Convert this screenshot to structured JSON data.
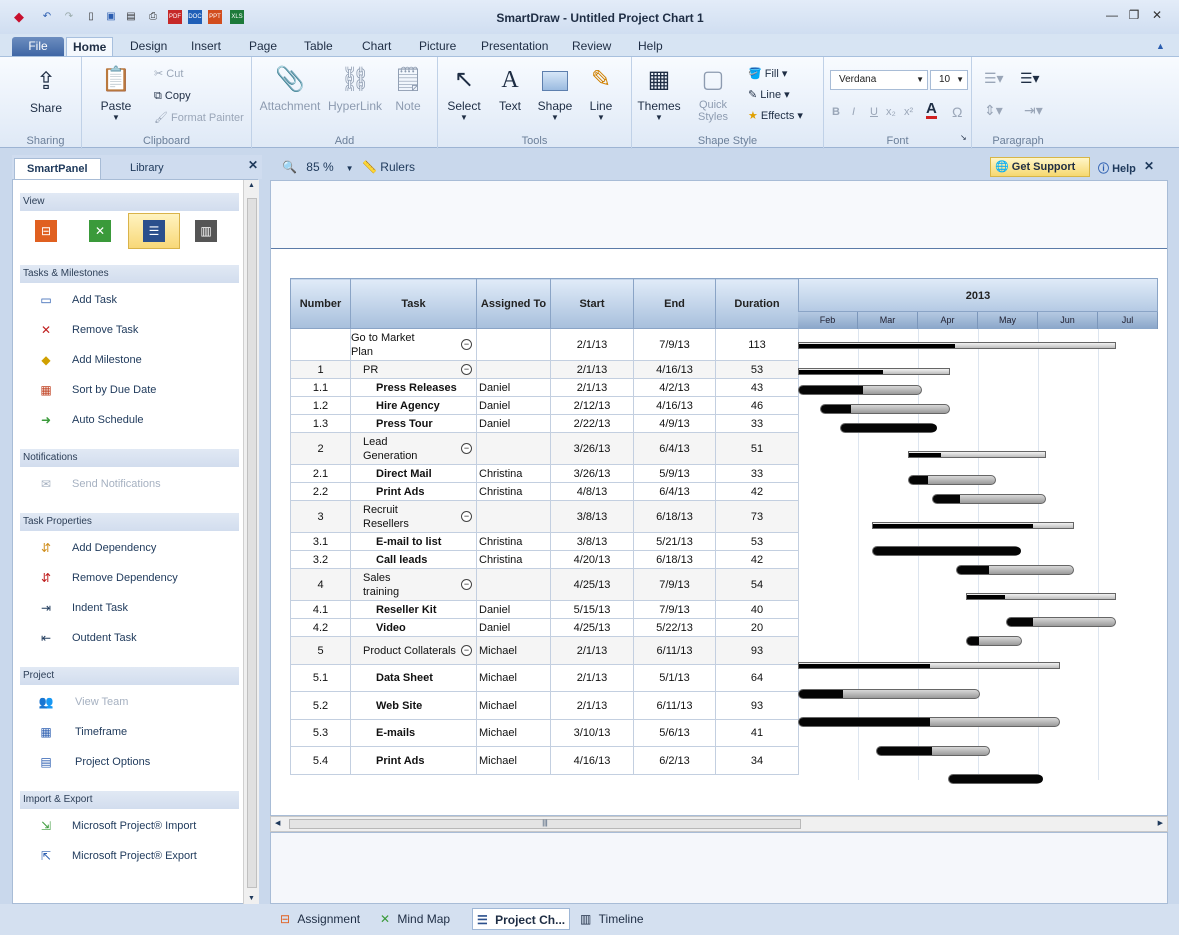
{
  "app": {
    "title": "SmartDraw - Untitled Project Chart 1"
  },
  "ribbon_tabs": [
    "File",
    "Home",
    "Design",
    "Insert",
    "Page",
    "Table",
    "Chart",
    "Picture",
    "Presentation",
    "Review",
    "Help"
  ],
  "ribbon": {
    "sharing": {
      "label": "Sharing",
      "share": "Share"
    },
    "clipboard": {
      "label": "Clipboard",
      "paste": "Paste",
      "cut": "Cut",
      "copy": "Copy",
      "format_painter": "Format Painter"
    },
    "add": {
      "label": "Add",
      "attachment": "Attachment",
      "hyperlink": "HyperLink",
      "note": "Note"
    },
    "tools": {
      "label": "Tools",
      "select": "Select",
      "text": "Text",
      "shape": "Shape",
      "line": "Line"
    },
    "shape_style": {
      "label": "Shape Style",
      "themes": "Themes",
      "quick_styles_1": "Quick",
      "quick_styles_2": "Styles",
      "fill": "Fill",
      "line": "Line",
      "effects": "Effects"
    },
    "font": {
      "label": "Font",
      "face": "Verdana",
      "size": "10"
    },
    "paragraph": {
      "label": "Paragraph"
    }
  },
  "panel": {
    "tabs": [
      "SmartPanel",
      "Library"
    ],
    "sections": {
      "view": "View",
      "tasks": "Tasks & Milestones",
      "notifications": "Notifications",
      "task_props": "Task Properties",
      "project": "Project",
      "import_export": "Import & Export"
    },
    "tasks_items": [
      "Add Task",
      "Remove Task",
      "Add Milestone",
      "Sort by Due Date",
      "Auto Schedule"
    ],
    "notif_items": [
      "Send Notifications"
    ],
    "prop_items": [
      "Add Dependency",
      "Remove Dependency",
      "Indent Task",
      "Outdent Task"
    ],
    "project_items": [
      "View Team",
      "Timeframe",
      "Project Options"
    ],
    "ie_items": [
      "Microsoft Project® Import",
      "Microsoft Project® Export"
    ]
  },
  "canvas_toolbar": {
    "zoom": "85 %",
    "rulers": "Rulers",
    "get_support": "Get Support",
    "help": "Help"
  },
  "table": {
    "headers": [
      "Number",
      "Task",
      "Assigned To",
      "Start",
      "End",
      "Duration"
    ],
    "year": "2013",
    "months": [
      "Feb",
      "Mar",
      "Apr",
      "May",
      "Jun",
      "Jul"
    ],
    "rows": [
      {
        "num": "",
        "task1": "Go to Market",
        "task2": "Plan",
        "assigned": "",
        "start": "2/1/13",
        "end": "7/9/13",
        "dur": "113",
        "level": 0,
        "summary": true,
        "h": 32,
        "bar": [
          0,
          318
        ],
        "prog": 0.49
      },
      {
        "num": "1",
        "task1": "PR",
        "task2": "",
        "assigned": "",
        "start": "2/1/13",
        "end": "4/16/13",
        "dur": "53",
        "level": 1,
        "summary": true,
        "h": 18,
        "bar": [
          0,
          152
        ],
        "prog": 0.55
      },
      {
        "num": "1.1",
        "task1": "Press Releases",
        "task2": "",
        "assigned": "Daniel",
        "start": "2/1/13",
        "end": "4/2/13",
        "dur": "43",
        "level": 2,
        "summary": false,
        "h": 18,
        "bar": [
          0,
          124
        ],
        "prog": 0.52
      },
      {
        "num": "1.2",
        "task1": "Hire Agency",
        "task2": "",
        "assigned": "Daniel",
        "start": "2/12/13",
        "end": "4/16/13",
        "dur": "46",
        "level": 2,
        "summary": false,
        "h": 18,
        "bar": [
          22,
          152
        ],
        "prog": 0.23
      },
      {
        "num": "1.3",
        "task1": "Press Tour",
        "task2": "",
        "assigned": "Daniel",
        "start": "2/22/13",
        "end": "4/9/13",
        "dur": "33",
        "level": 2,
        "summary": false,
        "h": 18,
        "bar": [
          42,
          138
        ],
        "prog": 1.0
      },
      {
        "num": "2",
        "task1": "Lead",
        "task2": "Generation",
        "assigned": "",
        "start": "3/26/13",
        "end": "6/4/13",
        "dur": "51",
        "level": 1,
        "summary": true,
        "h": 32,
        "bar": [
          110,
          248
        ],
        "prog": 0.23
      },
      {
        "num": "2.1",
        "task1": "Direct Mail",
        "task2": "",
        "assigned": "Christina",
        "start": "3/26/13",
        "end": "5/9/13",
        "dur": "33",
        "level": 2,
        "summary": false,
        "h": 18,
        "bar": [
          110,
          198
        ],
        "prog": 0.22
      },
      {
        "num": "2.2",
        "task1": "Print Ads",
        "task2": "",
        "assigned": "Christina",
        "start": "4/8/13",
        "end": "6/4/13",
        "dur": "42",
        "level": 2,
        "summary": false,
        "h": 18,
        "bar": [
          134,
          248
        ],
        "prog": 0.24
      },
      {
        "num": "3",
        "task1": "Recruit",
        "task2": "Resellers",
        "assigned": "",
        "start": "3/8/13",
        "end": "6/18/13",
        "dur": "73",
        "level": 1,
        "summary": true,
        "h": 32,
        "bar": [
          74,
          276
        ],
        "prog": 0.79
      },
      {
        "num": "3.1",
        "task1": "E-mail to list",
        "task2": "",
        "assigned": "Christina",
        "start": "3/8/13",
        "end": "5/21/13",
        "dur": "53",
        "level": 2,
        "summary": false,
        "h": 18,
        "bar": [
          74,
          222
        ],
        "prog": 1.0
      },
      {
        "num": "3.2",
        "task1": "Call leads",
        "task2": "",
        "assigned": "Christina",
        "start": "4/20/13",
        "end": "6/18/13",
        "dur": "42",
        "level": 2,
        "summary": false,
        "h": 18,
        "bar": [
          158,
          276
        ],
        "prog": 0.27
      },
      {
        "num": "4",
        "task1": "Sales",
        "task2": "training",
        "assigned": "",
        "start": "4/25/13",
        "end": "7/9/13",
        "dur": "54",
        "level": 1,
        "summary": true,
        "h": 32,
        "bar": [
          168,
          318
        ],
        "prog": 0.25
      },
      {
        "num": "4.1",
        "task1": "Reseller Kit",
        "task2": "",
        "assigned": "Daniel",
        "start": "5/15/13",
        "end": "7/9/13",
        "dur": "40",
        "level": 2,
        "summary": false,
        "h": 18,
        "bar": [
          208,
          318
        ],
        "prog": 0.24
      },
      {
        "num": "4.2",
        "task1": "Video",
        "task2": "",
        "assigned": "Daniel",
        "start": "4/25/13",
        "end": "5/22/13",
        "dur": "20",
        "level": 2,
        "summary": false,
        "h": 18,
        "bar": [
          168,
          224
        ],
        "prog": 0.22
      },
      {
        "num": "5",
        "task1": "Product Collaterals",
        "task2": "",
        "assigned": "Michael",
        "start": "2/1/13",
        "end": "6/11/13",
        "dur": "93",
        "level": 1,
        "summary": true,
        "h": 28,
        "bar": [
          0,
          262
        ],
        "prog": 0.5
      },
      {
        "num": "5.1",
        "task1": "Data Sheet",
        "task2": "",
        "assigned": "Michael",
        "start": "2/1/13",
        "end": "5/1/13",
        "dur": "64",
        "level": 2,
        "summary": false,
        "h": 27,
        "bar": [
          0,
          182
        ],
        "prog": 0.24
      },
      {
        "num": "5.2",
        "task1": "Web Site",
        "task2": "",
        "assigned": "Michael",
        "start": "2/1/13",
        "end": "6/11/13",
        "dur": "93",
        "level": 2,
        "summary": false,
        "h": 28,
        "bar": [
          0,
          262
        ],
        "prog": 0.5
      },
      {
        "num": "5.3",
        "task1": "E-mails",
        "task2": "",
        "assigned": "Michael",
        "start": "3/10/13",
        "end": "5/6/13",
        "dur": "41",
        "level": 2,
        "summary": false,
        "h": 27,
        "bar": [
          78,
          192
        ],
        "prog": 0.48
      },
      {
        "num": "5.4",
        "task1": "Print Ads",
        "task2": "",
        "assigned": "Michael",
        "start": "4/16/13",
        "end": "6/2/13",
        "dur": "34",
        "level": 2,
        "summary": false,
        "h": 28,
        "bar": [
          150,
          244
        ],
        "prog": 1.0
      }
    ]
  },
  "view_tabs": [
    "Assignment",
    "Mind Map",
    "Project Ch...",
    "Timeline"
  ]
}
